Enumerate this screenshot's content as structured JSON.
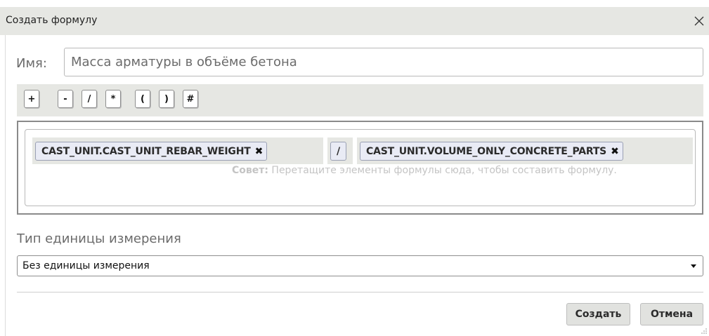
{
  "dialog": {
    "title": "Создать формулу",
    "close_icon": "close-icon"
  },
  "name_field": {
    "label": "Имя:",
    "value": "Масса арматуры в объёме бетона"
  },
  "operators": [
    "+",
    "-",
    "/",
    "*",
    "(",
    ")",
    "#"
  ],
  "formula": {
    "hint_bold": "Совет:",
    "hint_text": " Перетащите элементы формулы сюда, чтобы составить формулу.",
    "tokens": [
      {
        "label": "CAST_UNIT.CAST_UNIT_REBAR_WEIGHT",
        "remove_glyph": "✖"
      },
      {
        "label": "/"
      },
      {
        "label": "CAST_UNIT.VOLUME_ONLY_CONCRETE_PARTS",
        "remove_glyph": "✖"
      }
    ]
  },
  "unit_type": {
    "label": "Тип единицы измерения",
    "selected": "Без единицы измерения"
  },
  "buttons": {
    "create": "Создать",
    "cancel": "Отмена"
  }
}
